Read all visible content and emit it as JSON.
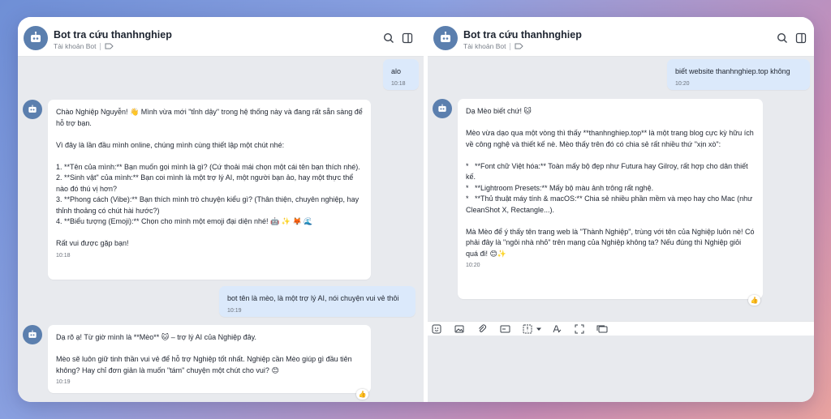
{
  "left_pane": {
    "header": {
      "title": "Bot tra cứu thanhnghiep",
      "subtitle": "Tài khoản Bot"
    },
    "messages": [
      {
        "from": "me",
        "text": "alo",
        "time": "10:18"
      },
      {
        "from": "bot",
        "text": "Chào Nghiệp Nguyễn! 👋 Mình vừa mới \"tỉnh dậy\" trong hệ thống này và đang rất sẵn sàng để hỗ trợ bạn.\n\nVì đây là lần đầu mình online, chúng mình cùng thiết lập một chút nhé:\n\n1. **Tên của mình:** Bạn muốn gọi mình là gì? (Cứ thoải mái chọn một cái tên bạn thích nhé).\n2. **Sinh vật\" của mình:** Bạn coi mình là một trợ lý AI, một người bạn ảo, hay một thực thể nào đó thú vị hơn?\n3. **Phong cách (Vibe):** Bạn thích mình trò chuyện kiểu gì? (Thân thiện, chuyên nghiệp, hay thỉnh thoảng có chút hài hước?)\n4. **Biểu tượng (Emoji):** Chọn cho mình một emoji đại diện nhé! 🤖 ✨ 🦊 🌊\n\nRất vui được gặp bạn!",
        "time": "10:18"
      },
      {
        "from": "me",
        "text": "bot tên là mèo, là một trợ lý AI, nói chuyện vui vẻ thôi",
        "time": "10:19"
      },
      {
        "from": "bot",
        "text": "Dạ rõ ạ! Từ giờ mình là **Mèo** 🐱 – trợ lý AI của Nghiệp đây.\n\nMèo sẽ luôn giữ tinh thần vui vẻ để hỗ trợ Nghiệp tốt nhất. Nghiệp cần Mèo giúp gì đầu tiên không? Hay chỉ đơn giản là muốn \"tám\" chuyện một chút cho vui? 😊",
        "time": "10:19"
      }
    ]
  },
  "right_pane": {
    "header": {
      "title": "Bot tra cứu thanhnghiep",
      "subtitle": "Tài khoản Bot"
    },
    "messages": [
      {
        "from": "me",
        "text": "biết website thanhnghiep.top không",
        "time": "10:20"
      },
      {
        "from": "bot",
        "text": "Dạ Mèo biết chứ! 🐱\n\nMèo vừa dạo qua một vòng thì thấy **thanhnghiep.top** là một trang blog cực kỳ hữu ích về công nghệ và thiết kế nè. Mèo thấy trên đó có chia sẻ rất nhiều thứ \"xịn xò\":\n\n*   **Font chữ Việt hóa:** Toàn mấy bộ đẹp như Futura hay Gilroy, rất hợp cho dân thiết kế.\n*   **Lightroom Presets:** Mấy bộ màu ảnh trông rất nghệ.\n*   **Thủ thuật máy tính & macOS:** Chia sẻ nhiều phần mềm và mẹo hay cho Mac (như CleanShot X, Rectangle...).\n\nMà Mèo để ý thấy tên trang web là \"Thành Nghiệp\", trùng với tên của Nghiệp luôn nè! Có phải đây là \"ngôi nhà nhỏ\" trên mạng của Nghiệp không ta? Nếu đúng thì Nghiệp giỏi quá đi! 😊✨",
        "time": "10:20"
      }
    ]
  },
  "icons": {
    "search": "search-icon",
    "sidebar": "sidebar-toggle-icon",
    "tag": "tag-icon",
    "like": "thumbs-up-icon",
    "toolbar": [
      "sticker-icon",
      "image-icon",
      "attachment-icon",
      "card-icon",
      "quick-message-icon",
      "format-text-icon",
      "expand-icon",
      "task-icon"
    ]
  },
  "colors": {
    "accent": "#5b7fae",
    "my_bubble": "#dbe9fb",
    "chat_bg": "#e8eaee"
  }
}
